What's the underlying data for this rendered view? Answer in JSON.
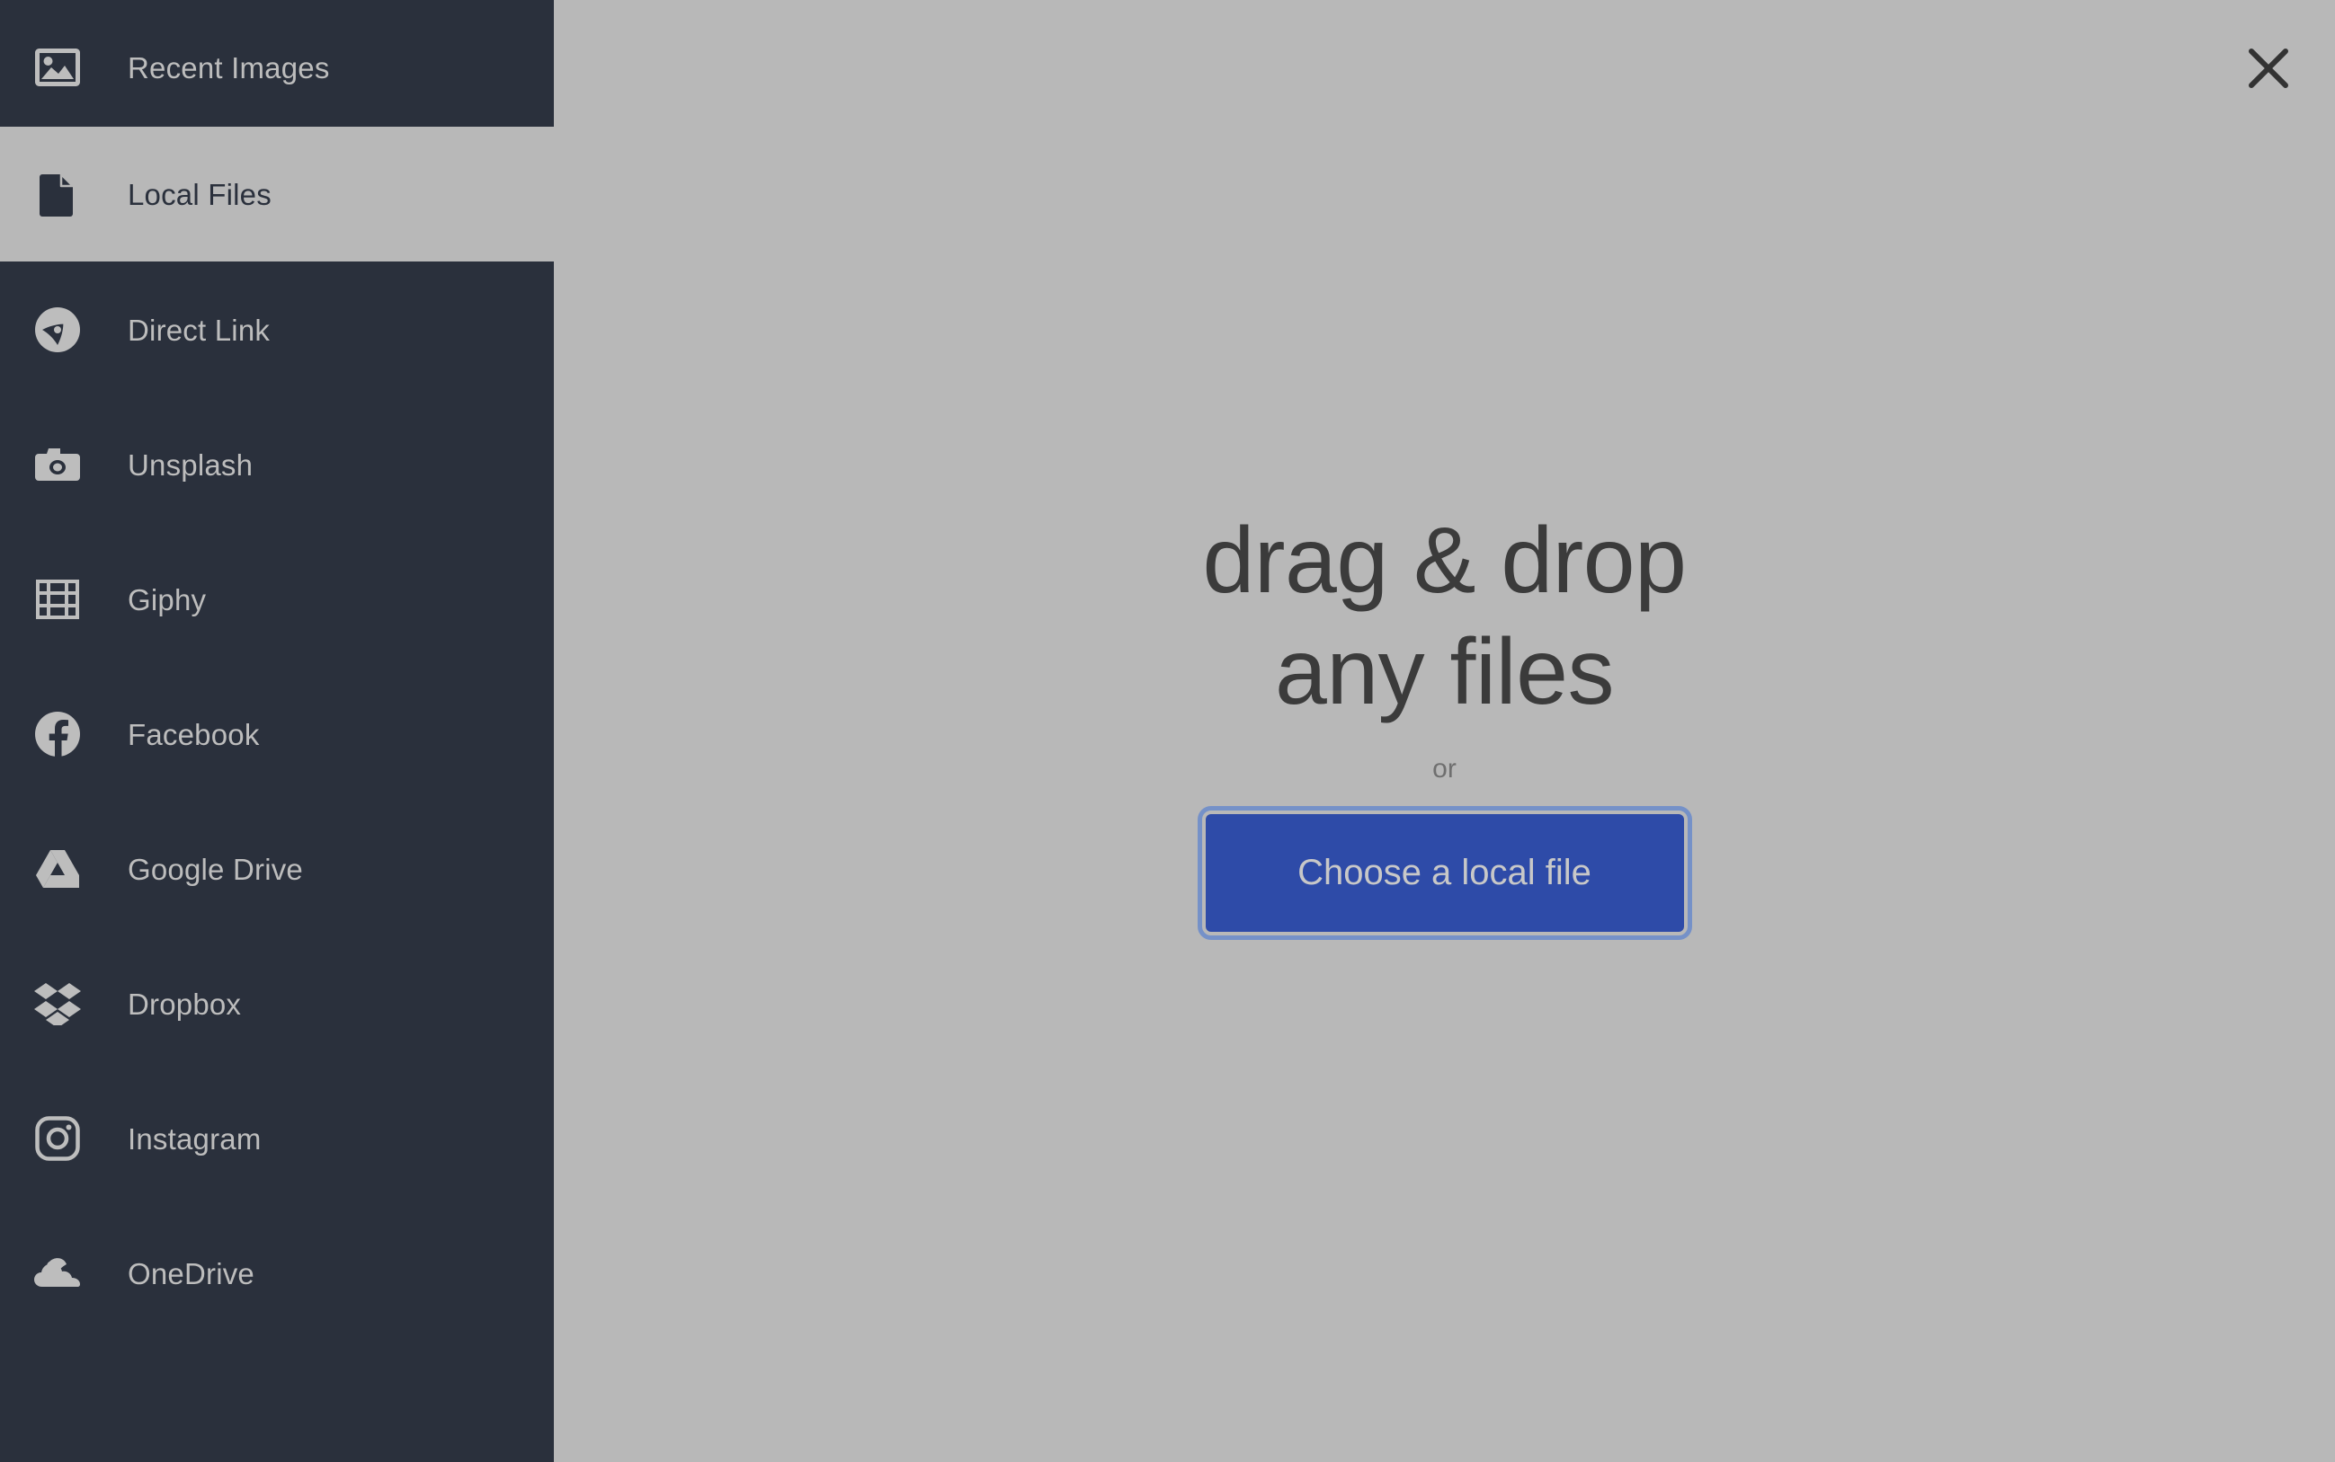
{
  "colors": {
    "sidebar_bg": "#2a303c",
    "main_bg": "#b8b8b8",
    "sidebar_text": "#bdbdbd",
    "active_item_bg": "#b8b8b8",
    "active_item_text": "#2a303c",
    "heading_text": "#3b3b3b",
    "or_text": "#6f6f6f",
    "button_bg": "#2e4ba8",
    "button_text": "#c8c8c8",
    "button_focus_ring": "#7591c8"
  },
  "sidebar": {
    "items": [
      {
        "label": "Recent Images",
        "icon": "image-icon",
        "active": false
      },
      {
        "label": "Local Files",
        "icon": "document-icon",
        "active": true
      },
      {
        "label": "Direct Link",
        "icon": "link-compass-icon",
        "active": false
      },
      {
        "label": "Unsplash",
        "icon": "camera-icon",
        "active": false
      },
      {
        "label": "Giphy",
        "icon": "film-strip-icon",
        "active": false
      },
      {
        "label": "Facebook",
        "icon": "facebook-icon",
        "active": false
      },
      {
        "label": "Google Drive",
        "icon": "google-drive-icon",
        "active": false
      },
      {
        "label": "Dropbox",
        "icon": "dropbox-icon",
        "active": false
      },
      {
        "label": "Instagram",
        "icon": "instagram-icon",
        "active": false
      },
      {
        "label": "OneDrive",
        "icon": "onedrive-icon",
        "active": false
      }
    ]
  },
  "main": {
    "close_icon": "close-icon",
    "drop_heading": "drag & drop\nany files",
    "or_label": "or",
    "choose_file_label": "Choose a local file"
  }
}
